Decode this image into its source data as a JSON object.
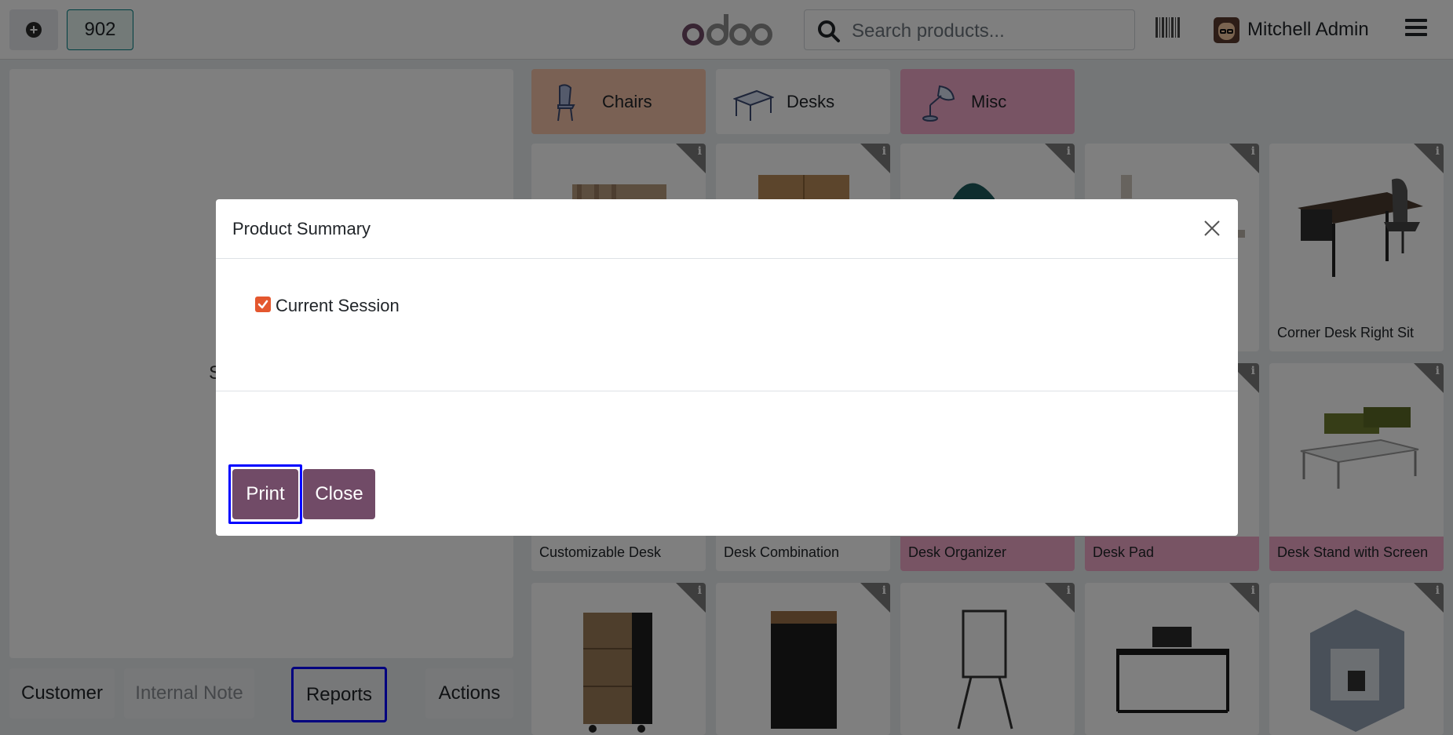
{
  "topbar": {
    "order_number": "902",
    "logo_text": "odoo",
    "search_placeholder": "Search products...",
    "user_name": "Mitchell Admin"
  },
  "left_pane": {
    "partial_glyph": "S",
    "buttons": {
      "customer": "Customer",
      "internal_note": "Internal Note",
      "reports": "Reports",
      "actions": "Actions"
    }
  },
  "categories": [
    {
      "label": "Chairs",
      "color": "#f4c3a8"
    },
    {
      "label": "Desks",
      "color": "#ffffff"
    },
    {
      "label": "Misc",
      "color": "#f0a9c8"
    }
  ],
  "products": {
    "row1_last": "Corner Desk Right Sit",
    "row2": [
      "Customizable Desk",
      "Desk Combination",
      "Desk Organizer",
      "Desk Pad",
      "Desk Stand with Screen"
    ]
  },
  "modal": {
    "title": "Product Summary",
    "checkbox_label": "Current Session",
    "checkbox_checked": true,
    "print_label": "Print",
    "close_label": "Close"
  },
  "colors": {
    "brand": "#714b67",
    "highlight": "#0000ff",
    "checkbox": "#e4572e"
  }
}
